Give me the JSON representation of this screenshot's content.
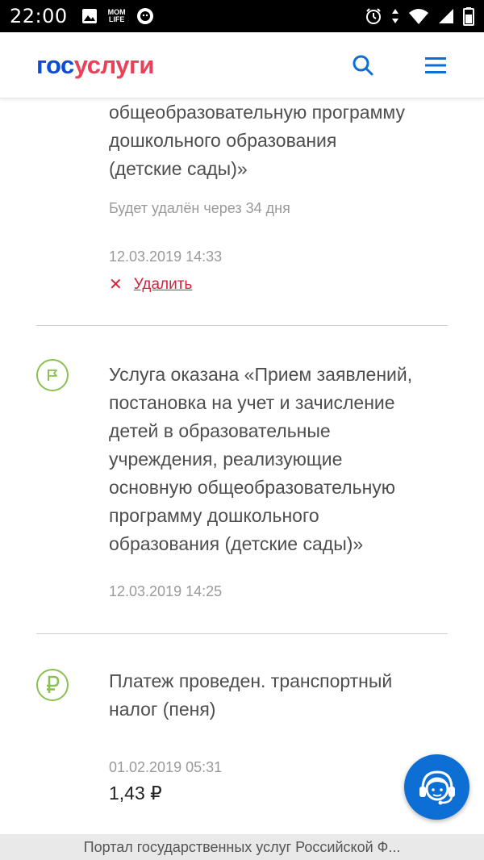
{
  "status_bar": {
    "time": "22:00",
    "mom_life_line1": "MOM",
    "mom_life_line2": "LIFE",
    "icons": [
      "image-icon",
      "mom-life-icon",
      "lion-icon",
      "alarm-icon",
      "data-arrows-icon",
      "wifi-icon",
      "signal-icon",
      "battery-icon"
    ]
  },
  "header": {
    "logo_part1": "гос",
    "logo_part2": "услуги",
    "colors": {
      "brand_blue": "#0d4cd3",
      "brand_red": "#ee3f58",
      "accent": "#0d6ed3"
    },
    "icons": [
      "search-icon",
      "menu-icon"
    ]
  },
  "feed": {
    "top_item": {
      "text_lines": [
        "общеобразовательную программу",
        "дошкольного образования",
        "(детские сады)»"
      ],
      "expiry_note": "Будет удалён через 34 дня",
      "timestamp": "12.03.2019 14:33",
      "delete_label": "Удалить"
    },
    "service_item": {
      "icon": "flag-icon",
      "text_lines": [
        "Услуга оказана «Прием заявлений,",
        "постановка на учет и зачисление",
        "детей в образовательные",
        "учреждения, реализующие",
        "основную общеобразовательную",
        "программу дошкольного",
        "образования (детские сады)»"
      ],
      "timestamp": "12.03.2019 14:25"
    },
    "payment_item": {
      "icon": "ruble-icon",
      "text_lines": [
        "Платеж проведен. транспортный",
        "налог (пеня)"
      ],
      "timestamp": "01.02.2019 05:31",
      "amount": "1,43 ₽"
    }
  },
  "support_button": {
    "icon": "support-agent-icon"
  },
  "footer": {
    "text": "Портал государственных услуг Российской Ф..."
  }
}
